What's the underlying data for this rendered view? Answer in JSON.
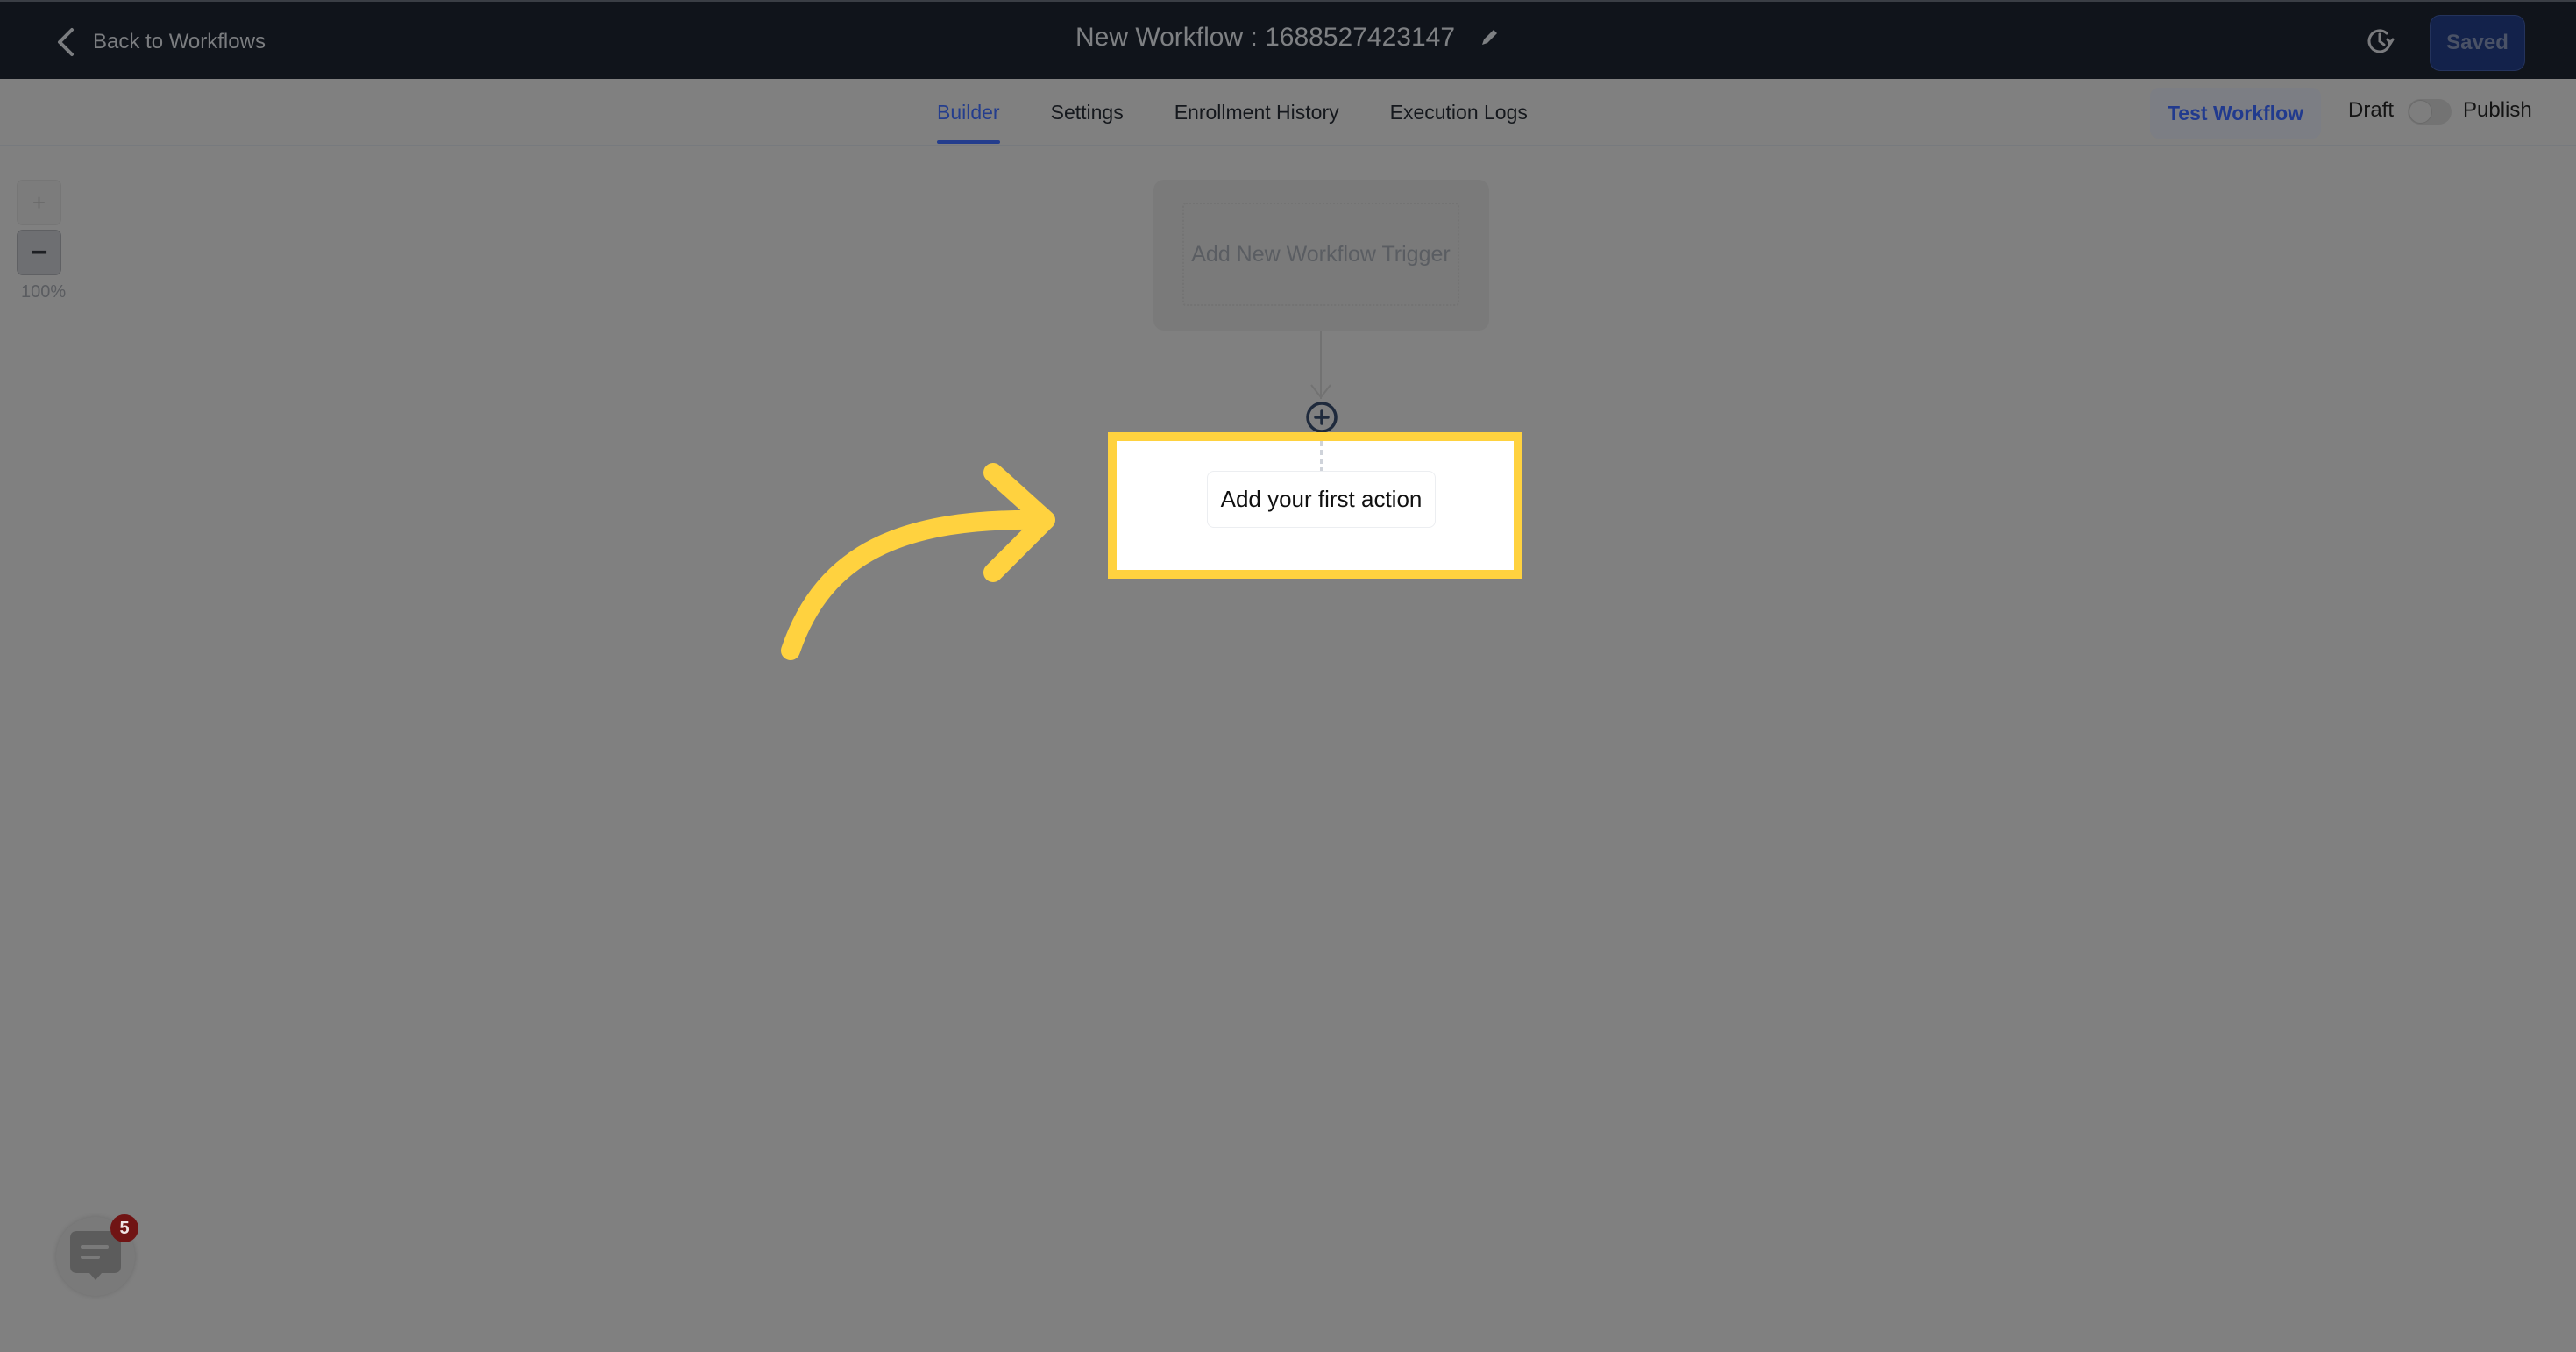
{
  "header": {
    "back_label": "Back to Workflows",
    "workflow_title": "New Workflow : 1688527423147",
    "saved_label": "Saved"
  },
  "tabs": [
    {
      "label": "Builder",
      "active": true
    },
    {
      "label": "Settings",
      "active": false
    },
    {
      "label": "Enrollment History",
      "active": false
    },
    {
      "label": "Execution Logs",
      "active": false
    }
  ],
  "toolbar": {
    "test_label": "Test Workflow",
    "draft_label": "Draft",
    "publish_label": "Publish",
    "published": false
  },
  "zoom": {
    "in_label": "+",
    "out_label": "−",
    "level": "100%"
  },
  "canvas": {
    "trigger_label": "Add New Workflow Trigger",
    "action_label": "Add your first action"
  },
  "chat": {
    "unread_count": "5"
  },
  "colors": {
    "highlight": "#ffd23f",
    "accent": "#243d8d",
    "header_bg": "#10141b"
  }
}
